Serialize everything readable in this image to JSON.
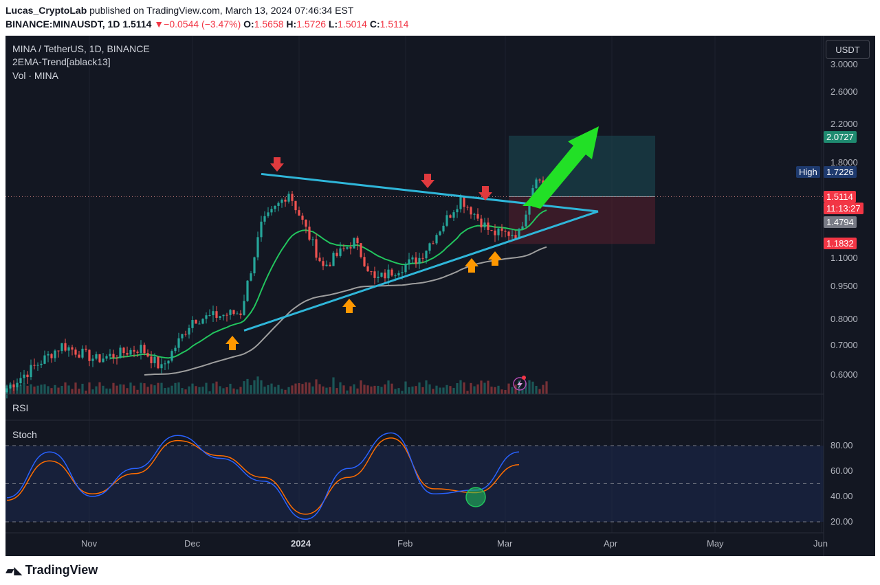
{
  "header": {
    "author": "Lucas_CryptoLab",
    "published_text": "published on TradingView.com, March 13, 2024 07:46:34 EST",
    "symbol": "BINANCE:MINAUSDT, 1D",
    "last": "1.5114",
    "change_arrow": "▼",
    "change": "−0.0544 (−3.47%)",
    "o_label": "O:",
    "o_val": "1.5658",
    "h_label": "H:",
    "h_val": "1.5726",
    "l_label": "L:",
    "l_val": "1.5014",
    "c_label": "C:",
    "c_val": "1.5114"
  },
  "legend": {
    "title": "MINA / TetherUS, 1D, BINANCE",
    "indicator": "2EMA-Trend[ablack13]",
    "volume": "Vol · MINA"
  },
  "currency_button": "USDT",
  "price_axis": {
    "ticks": [
      "3.0000",
      "2.6000",
      "2.2000",
      "1.8000",
      "1.1000",
      "0.9500",
      "0.8000",
      "0.7000",
      "0.6000"
    ]
  },
  "badges": {
    "target": "2.0727",
    "high_label": "High",
    "high_value": "1.7226",
    "last_price": "1.5114",
    "countdown": "11:13:27",
    "gray": "1.4794",
    "stop": "1.1832"
  },
  "panes": {
    "rsi": "RSI",
    "stoch": "Stoch"
  },
  "stoch_axis": [
    "80.00",
    "60.00",
    "40.00",
    "20.00"
  ],
  "time_axis": [
    "Nov",
    "Dec",
    "2024",
    "Feb",
    "Mar",
    "Apr",
    "May",
    "Jun"
  ],
  "footer": {
    "logo": "TradingView"
  },
  "colors": {
    "bg": "#131722",
    "up": "#26a69a",
    "down": "#ef5350",
    "trendline": "#2fb6d9",
    "ema_fast": "#22c55e",
    "ema_slow": "#9e9e9e",
    "arrow_red": "#e03a3e",
    "arrow_orange": "#ff9800",
    "arrow_green": "#22e026",
    "stoch_k": "#2962ff",
    "stoch_d": "#ff6d00"
  },
  "chart_data": {
    "type": "candlestick",
    "symbol": "MINAUSDT",
    "interval": "1D",
    "exchange": "BINANCE",
    "y_scale": "log",
    "ylim": [
      0.55,
      3.2
    ],
    "x_range": [
      "2023-10-08",
      "2024-06-12"
    ],
    "ohlc_anchors": [
      {
        "date": "2023-10-08",
        "close": 0.56
      },
      {
        "date": "2023-10-24",
        "close": 0.7
      },
      {
        "date": "2023-11-03",
        "close": 0.65
      },
      {
        "date": "2023-11-16",
        "close": 0.69
      },
      {
        "date": "2023-11-22",
        "close": 0.62
      },
      {
        "date": "2023-12-01",
        "close": 0.8
      },
      {
        "date": "2023-12-15",
        "close": 0.83
      },
      {
        "date": "2023-12-21",
        "close": 1.3
      },
      {
        "date": "2023-12-29",
        "close": 1.55
      },
      {
        "date": "2024-01-08",
        "close": 1.05
      },
      {
        "date": "2024-01-17",
        "close": 1.2
      },
      {
        "date": "2024-01-23",
        "close": 0.98
      },
      {
        "date": "2024-02-05",
        "close": 1.1
      },
      {
        "date": "2024-02-13",
        "close": 1.35
      },
      {
        "date": "2024-02-17",
        "close": 1.5
      },
      {
        "date": "2024-02-26",
        "close": 1.25
      },
      {
        "date": "2024-03-05",
        "close": 1.25
      },
      {
        "date": "2024-03-10",
        "close": 1.7
      },
      {
        "date": "2024-03-13",
        "close": 1.5114
      }
    ],
    "last_bar": {
      "open": 1.5658,
      "high": 1.5726,
      "low": 1.5014,
      "close": 1.5114
    },
    "levels": {
      "target": 2.0727,
      "high": 1.7226,
      "entry": 1.5114,
      "gray": 1.4794,
      "stop": 1.1832
    },
    "trendlines": [
      {
        "from": {
          "date": "2023-12-21",
          "price": 1.7
        },
        "to": {
          "date": "2024-03-28",
          "price": 1.4
        }
      },
      {
        "from": {
          "date": "2023-12-16",
          "price": 0.755
        },
        "to": {
          "date": "2024-03-28",
          "price": 1.4
        }
      }
    ],
    "rsi_pane": {
      "title": "RSI"
    },
    "stoch_pane": {
      "title": "Stoch",
      "levels": [
        80,
        50,
        20
      ],
      "k_anchor": [
        39,
        75,
        40,
        62,
        88,
        70,
        52,
        22,
        62,
        90,
        42,
        45,
        75
      ],
      "d_anchor": [
        37,
        68,
        42,
        58,
        84,
        72,
        55,
        26,
        55,
        86,
        46,
        43,
        65
      ]
    }
  }
}
